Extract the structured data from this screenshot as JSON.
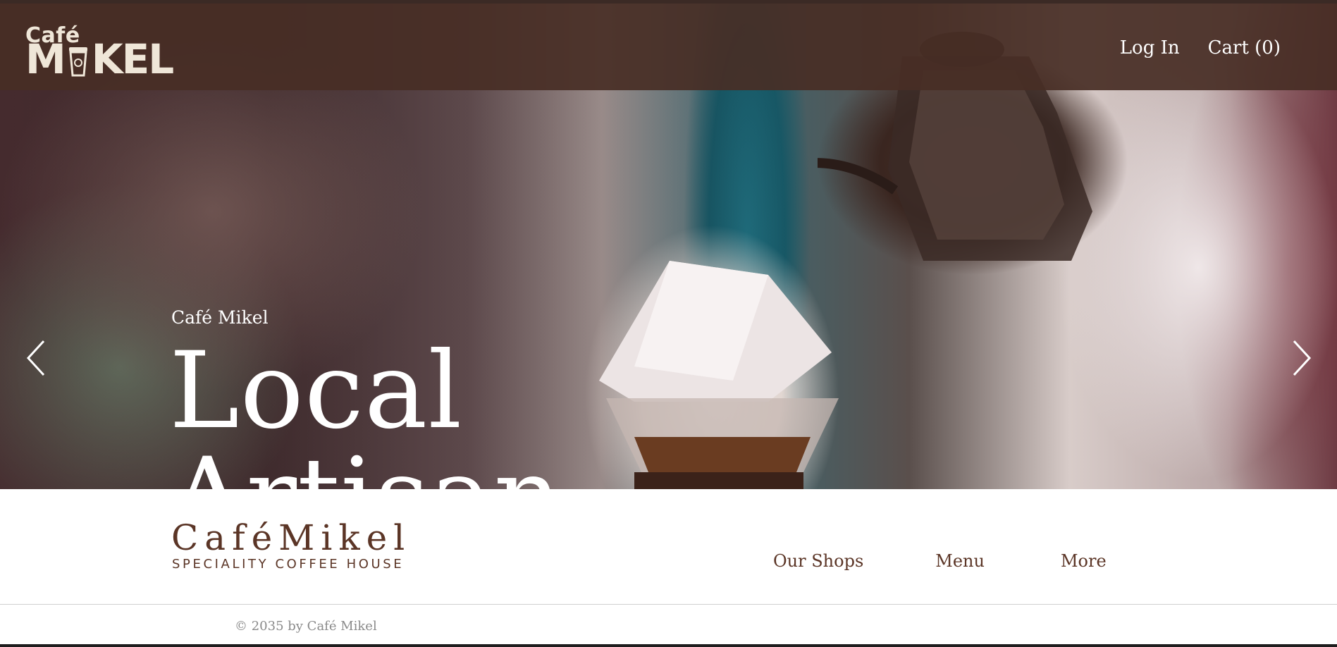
{
  "header": {
    "logo": {
      "line1": "Café",
      "line2_left": "M",
      "line2_right": "KEL"
    },
    "login_label": "Log In",
    "cart_label": "Cart (0)"
  },
  "hero": {
    "eyebrow": "Café Mikel",
    "headline": "Local Artisan",
    "prev_icon": "chevron-left-icon",
    "next_icon": "chevron-right-icon"
  },
  "brand": {
    "name": "CaféMikel",
    "tagline": "SPECIALITY COFFEE HOUSE"
  },
  "nav": {
    "our_shops": "Our Shops",
    "menu": "Menu",
    "more": "More"
  },
  "footer": {
    "copyright": "© 2035 by Café Mikel"
  },
  "colors": {
    "header_bg": "#482e25",
    "brand_brown": "#5b3526",
    "footer_text": "#8a8a8a"
  }
}
